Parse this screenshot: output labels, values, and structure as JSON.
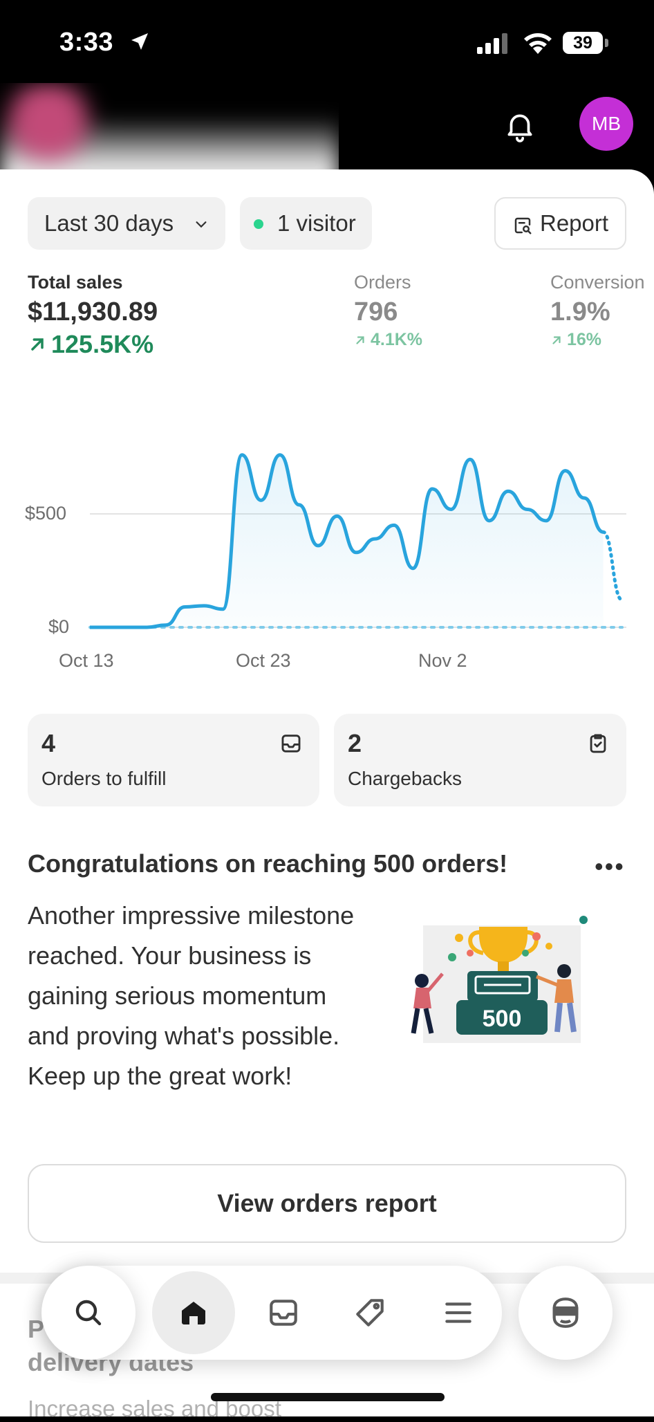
{
  "status": {
    "time": "3:33",
    "battery": "39"
  },
  "header": {
    "avatar_initials": "MB"
  },
  "filters": {
    "range": "Last 30 days",
    "visitors": "1 visitor",
    "report": "Report"
  },
  "metrics": [
    {
      "label": "Total sales",
      "value": "$11,930.89",
      "delta": "125.5K%"
    },
    {
      "label": "Orders",
      "value": "796",
      "delta": "4.1K%"
    },
    {
      "label": "Conversion",
      "value": "1.9%",
      "delta": "16%"
    }
  ],
  "chart_data": {
    "type": "line",
    "x_ticks": [
      "Oct 13",
      "Oct 23",
      "Nov 2"
    ],
    "y_ticks": [
      "$500",
      "$0"
    ],
    "ylim": [
      0,
      800
    ],
    "series": [
      {
        "values": [
          0,
          0,
          0,
          0,
          10,
          90,
          95,
          80,
          760,
          560,
          760,
          540,
          360,
          490,
          330,
          390,
          450,
          260,
          610,
          520,
          740,
          470,
          600,
          520,
          470,
          690,
          570,
          420,
          120
        ]
      },
      {
        "values": [
          0,
          0,
          0,
          0,
          0,
          0,
          0,
          0,
          0,
          0,
          0,
          0,
          0,
          0,
          0,
          0,
          0,
          0,
          0,
          0,
          0,
          0,
          0,
          0,
          0,
          0,
          0,
          0,
          0
        ]
      }
    ],
    "colors": {
      "current": "#29a4dd",
      "previous": "#7fcbea"
    }
  },
  "cards": [
    {
      "value": "4",
      "label": "Orders to fulfill",
      "icon": "inbox-icon"
    },
    {
      "value": "2",
      "label": "Chargebacks",
      "icon": "clipboard-check-icon"
    }
  ],
  "congrats": {
    "title": "Congratulations on reaching 500 orders!",
    "body": "Another impressive milestone reached. Your business is gaining serious momentum and proving what's possible. Keep up the great work!",
    "badge": "500",
    "button": "View orders report"
  },
  "next_card": {
    "title_start": "P",
    "title_mid": "fo",
    "title_line2": "delivery dates",
    "body": "Increase sales and boost"
  },
  "tabs": [
    "search-icon",
    "home-icon",
    "inbox-icon",
    "tag-icon",
    "menu-icon",
    "sidekick-icon"
  ]
}
